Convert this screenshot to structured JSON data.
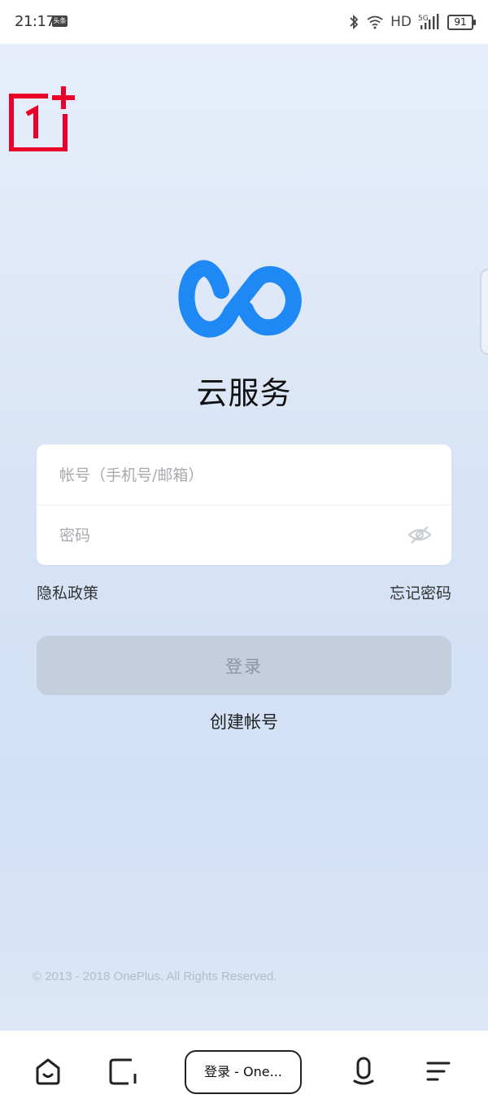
{
  "status_bar": {
    "time": "21:17",
    "app_badge": "头条",
    "network_label": "HD",
    "signal_label": "5G",
    "battery_level": "91"
  },
  "page": {
    "app_title": "云服务",
    "account_placeholder": "帐号（手机号/邮箱）",
    "password_placeholder": "密码",
    "privacy_link": "隐私政策",
    "forgot_password_link": "忘记密码",
    "login_button": "登录",
    "create_account_link": "创建帐号",
    "copyright": "© 2013 - 2018 OnePlus. All Rights Reserved."
  },
  "browser_bar": {
    "address_title": "登录 - One..."
  },
  "icons": {
    "brand": "oneplus-logo-icon",
    "app": "cloud-infinity-logo",
    "password_toggle": "eye-off-icon",
    "nav": [
      "home-icon",
      "tabs-icon",
      "mic-icon",
      "menu-icon"
    ]
  },
  "colors": {
    "brand_red": "#eb0029",
    "app_blue": "#1e88f5",
    "button_disabled_bg": "#c4cedc",
    "button_disabled_text": "#8b96a6"
  }
}
